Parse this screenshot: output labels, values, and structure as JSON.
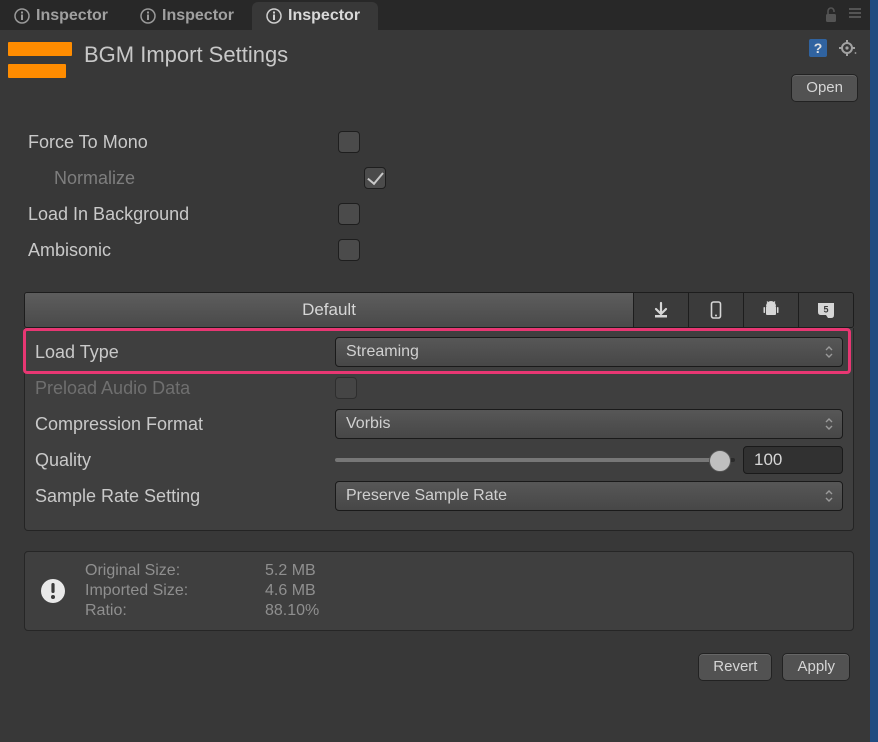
{
  "tabs": [
    {
      "label": "Inspector",
      "active": false
    },
    {
      "label": "Inspector",
      "active": false
    },
    {
      "label": "Inspector",
      "active": true
    }
  ],
  "header": {
    "title": "BGM Import Settings",
    "open_label": "Open"
  },
  "base_props": {
    "force_to_mono": {
      "label": "Force To Mono",
      "checked": false
    },
    "normalize": {
      "label": "Normalize",
      "checked": true
    },
    "load_bg": {
      "label": "Load In Background",
      "checked": false
    },
    "ambisonic": {
      "label": "Ambisonic",
      "checked": false
    }
  },
  "platform_tabs": {
    "default_label": "Default"
  },
  "settings": {
    "load_type": {
      "label": "Load Type",
      "value": "Streaming"
    },
    "preload": {
      "label": "Preload Audio Data",
      "checked": false
    },
    "compression": {
      "label": "Compression Format",
      "value": "Vorbis"
    },
    "quality": {
      "label": "Quality",
      "value": "100",
      "slider_pct": 96
    },
    "sample_rate": {
      "label": "Sample Rate Setting",
      "value": "Preserve Sample Rate"
    }
  },
  "info": {
    "original_label": "Original Size:",
    "original_value": "5.2 MB",
    "imported_label": "Imported Size:",
    "imported_value": "4.6 MB",
    "ratio_label": "Ratio:",
    "ratio_value": "88.10%"
  },
  "footer": {
    "revert": "Revert",
    "apply": "Apply"
  }
}
